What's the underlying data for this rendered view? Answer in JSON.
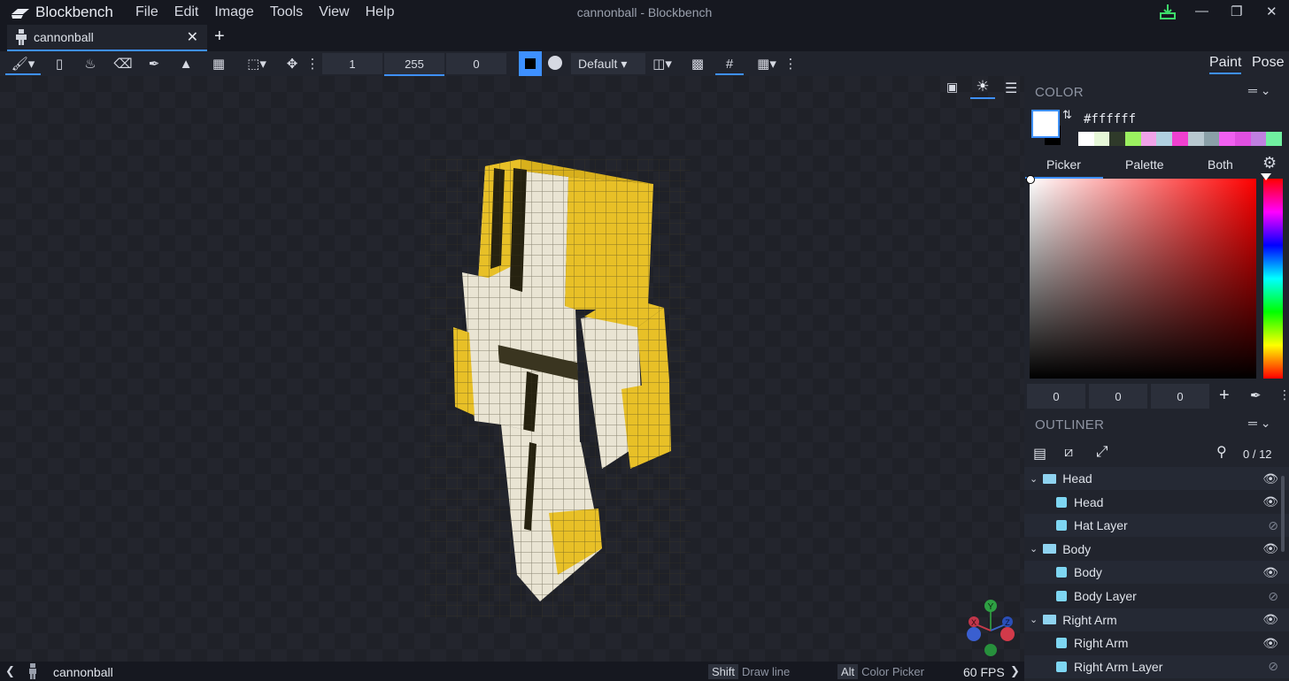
{
  "app": {
    "name": "Blockbench",
    "window_title": "cannonball - Blockbench",
    "menu": [
      "File",
      "Edit",
      "Image",
      "Tools",
      "View",
      "Help"
    ]
  },
  "tab": {
    "label": "cannonball"
  },
  "toolbar": {
    "brush_size": "1",
    "opacity": "255",
    "softness": "0",
    "blend_mode": "Default"
  },
  "modes": {
    "paint": "Paint",
    "pose": "Pose"
  },
  "color_panel": {
    "title": "COLOR",
    "hex": "#ffffff",
    "tabs": [
      "Picker",
      "Palette",
      "Both"
    ],
    "rgb": [
      "0",
      "0",
      "0"
    ],
    "palette": [
      "#ffffff",
      "#e6f7d8",
      "#2f3a2a",
      "#9bf060",
      "#f0a3e8",
      "#b0d0e0",
      "#f040d0",
      "#b8c8d0",
      "#8aa0a8",
      "#f060f0",
      "#e050e0",
      "#c080e0",
      "#70f0a0"
    ]
  },
  "outliner": {
    "title": "OUTLINER",
    "count": "0 / 12",
    "items": [
      {
        "label": "Head",
        "type": "group",
        "visible": true
      },
      {
        "label": "Head",
        "type": "cube",
        "visible": true
      },
      {
        "label": "Hat Layer",
        "type": "cube",
        "visible": false
      },
      {
        "label": "Body",
        "type": "group",
        "visible": true
      },
      {
        "label": "Body",
        "type": "cube",
        "visible": true
      },
      {
        "label": "Body Layer",
        "type": "cube",
        "visible": false
      },
      {
        "label": "Right Arm",
        "type": "group",
        "visible": true
      },
      {
        "label": "Right Arm",
        "type": "cube",
        "visible": true
      },
      {
        "label": "Right Arm Layer",
        "type": "cube",
        "visible": false
      }
    ]
  },
  "statusbar": {
    "project": "cannonball",
    "hint1_key": "Shift",
    "hint1_text": "Draw line",
    "hint2_key": "Alt",
    "hint2_text": "Color Picker",
    "fps": "60 FPS"
  },
  "gizmo": {
    "x": "X",
    "y": "Y",
    "z": "Z"
  }
}
